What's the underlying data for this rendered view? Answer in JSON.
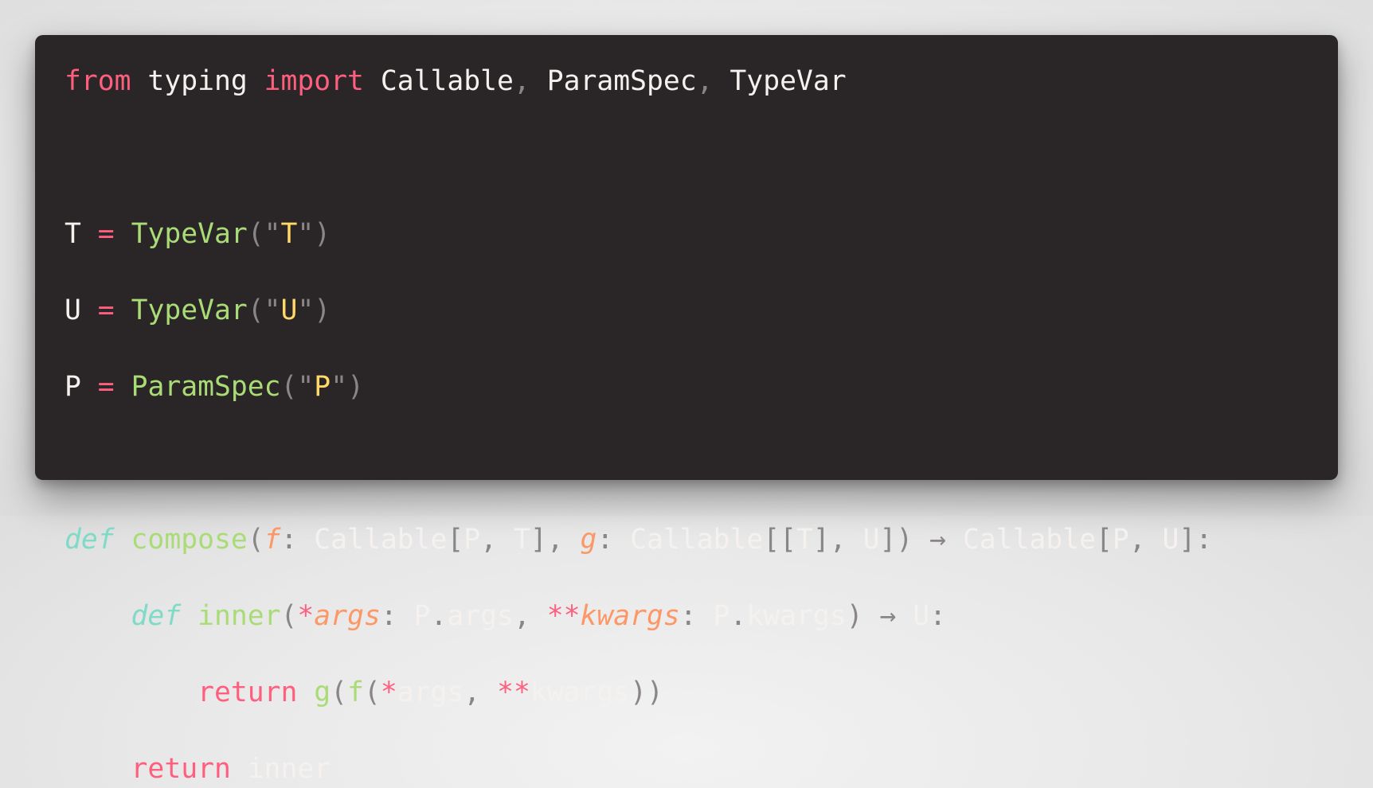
{
  "code": {
    "l1": {
      "kw_from": "from",
      "mod": " typing ",
      "kw_import": "import",
      "sp": " ",
      "n1": "Callable",
      "c1": ", ",
      "n2": "ParamSpec",
      "c2": ", ",
      "n3": "TypeVar"
    },
    "l3": {
      "name": "T",
      "sp1": " ",
      "eq": "=",
      "sp2": " ",
      "call": "TypeVar",
      "lp": "(\"",
      "lit": "T",
      "rp": "\")"
    },
    "l4": {
      "name": "U",
      "sp1": " ",
      "eq": "=",
      "sp2": " ",
      "call": "TypeVar",
      "lp": "(\"",
      "lit": "U",
      "rp": "\")"
    },
    "l5": {
      "name": "P",
      "sp1": " ",
      "eq": "=",
      "sp2": " ",
      "call": "ParamSpec",
      "lp": "(\"",
      "lit": "P",
      "rp": "\")"
    },
    "l7": {
      "kw_def": "def",
      "sp": " ",
      "fn": "compose",
      "lp": "(",
      "p1": "f",
      "colon1": ": ",
      "t1": "Callable",
      "b1o": "[",
      "t1a": "P",
      "c1": ", ",
      "t1b": "T",
      "b1c": "], ",
      "p2": "g",
      "colon2": ": ",
      "t2": "Callable",
      "b2o": "[[",
      "t2a": "T",
      "b2m": "], ",
      "t2b": "U",
      "b2c": "])",
      "arrow": " → ",
      "rt": "Callable",
      "b3o": "[",
      "rta": "P",
      "c3": ", ",
      "rtb": "U",
      "b3c": "]:"
    },
    "l8": {
      "indent": "    ",
      "kw_def": "def",
      "sp": " ",
      "fn": "inner",
      "lp": "(",
      "star1": "*",
      "p1": "args",
      "colon1": ": ",
      "t1a": "P",
      "dot1": ".",
      "t1b": "args",
      "c1": ", ",
      "star2": "**",
      "p2": "kwargs",
      "colon2": ": ",
      "t2a": "P",
      "dot2": ".",
      "t2b": "kwargs",
      "rp": ")",
      "arrow": " → ",
      "rt": "U",
      "colon3": ":"
    },
    "l9": {
      "indent": "        ",
      "kw_return": "return",
      "sp": " ",
      "g": "g",
      "lp1": "(",
      "f": "f",
      "lp2": "(",
      "star1": "*",
      "a1": "args",
      "c1": ", ",
      "star2": "**",
      "a2": "kwargs",
      "rp": "))"
    },
    "l10": {
      "indent": "    ",
      "kw_return": "return",
      "sp": " ",
      "name": "inner"
    }
  }
}
